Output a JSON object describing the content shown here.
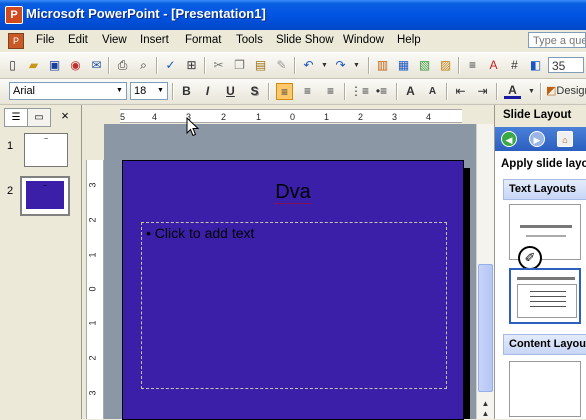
{
  "window": {
    "title": "Microsoft PowerPoint - [Presentation1]",
    "app_icon_glyph": "P"
  },
  "menu": {
    "items": [
      "File",
      "Edit",
      "View",
      "Insert",
      "Format",
      "Tools",
      "Slide Show",
      "Window",
      "Help"
    ],
    "ask_placeholder": "Type a question for help"
  },
  "toolbar_standard": {
    "zoom": "35"
  },
  "toolbar_formatting": {
    "font": "Arial",
    "size": "18",
    "bold": "B",
    "italic": "I",
    "underline": "U",
    "shadow": "S",
    "grow_font": "A",
    "shrink_font": "A",
    "font_color": "A",
    "design_label": "Design"
  },
  "slides_pane": {
    "close": "×",
    "slides": [
      {
        "number": "1",
        "title": "~"
      },
      {
        "number": "2",
        "title": "~"
      }
    ]
  },
  "ruler": {
    "horizontal": [
      "5",
      "4",
      "3",
      "2",
      "1",
      "0",
      "1",
      "2",
      "3",
      "4"
    ],
    "vertical": [
      "3",
      "2",
      "1",
      "0",
      "1",
      "2",
      "3"
    ]
  },
  "slide": {
    "title": "Dva",
    "body_placeholder": "Click to add text",
    "bullet": "•",
    "background_color": "#3b1fa8"
  },
  "task_pane": {
    "title": "Slide Layout",
    "apply_label": "Apply slide layout:",
    "text_layouts_label": "Text Layouts",
    "content_layouts_label": "Content Layouts"
  },
  "colors": {
    "titlebar": "#0054e3",
    "slide_background": "#3b1fa8",
    "workspace": "#8c97a6",
    "task_nav": "#2b5fc0"
  }
}
